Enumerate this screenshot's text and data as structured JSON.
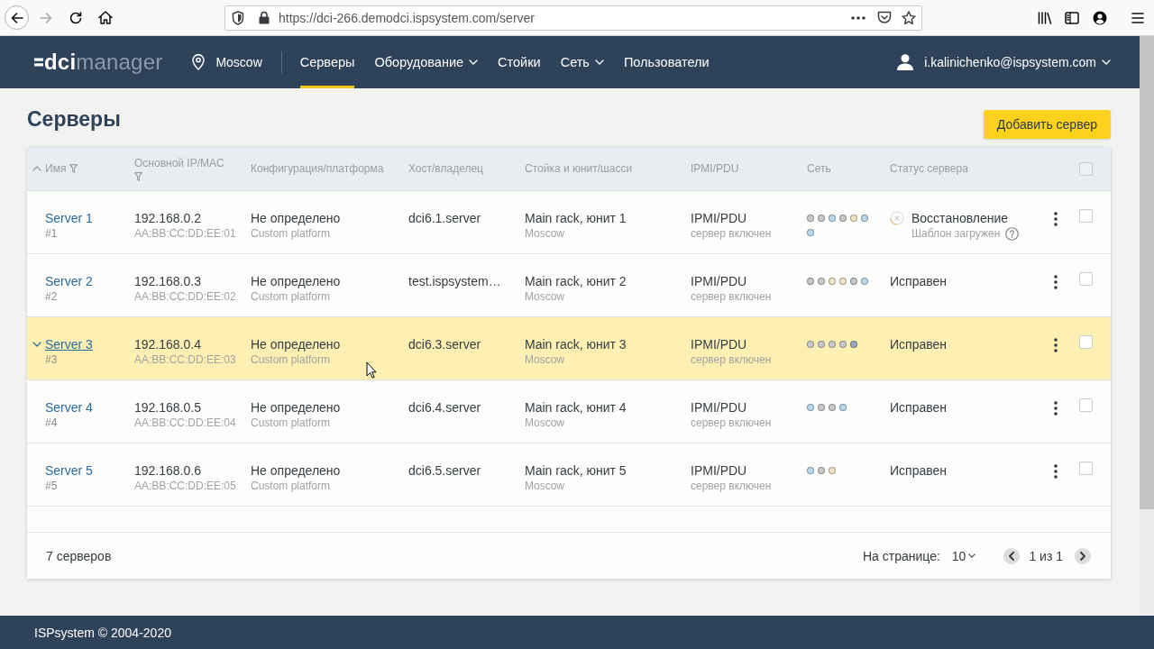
{
  "browser": {
    "url": "https://dci-266.demodci.ispsystem.com/server",
    "forward_disabled": true
  },
  "header": {
    "logo": "**dci**manager",
    "location": "Moscow",
    "nav": [
      {
        "label": "Серверы",
        "selected": true,
        "dropdown": false
      },
      {
        "label": "Оборудование",
        "selected": false,
        "dropdown": true
      },
      {
        "label": "Стойки",
        "selected": false,
        "dropdown": false
      },
      {
        "label": "Сеть",
        "selected": false,
        "dropdown": true
      },
      {
        "label": "Пользователи",
        "selected": false,
        "dropdown": false
      }
    ],
    "user": "i.kalinichenko@ispsystem.com"
  },
  "page": {
    "title": "Серверы",
    "add_button": "Добавить сервер"
  },
  "table": {
    "columns": [
      {
        "label": "Имя",
        "sorted": true,
        "filter": true
      },
      {
        "label": "Основной IP/MAC",
        "sorted": false,
        "filter": true
      },
      {
        "label": "Конфигурация/платформа",
        "sorted": false,
        "filter": false
      },
      {
        "label": "Хост/владелец",
        "sorted": false,
        "filter": false
      },
      {
        "label": "Стойка и юнит/шасси",
        "sorted": false,
        "filter": false
      },
      {
        "label": "IPMI/PDU",
        "sorted": false,
        "filter": false
      },
      {
        "label": "Сеть",
        "sorted": false,
        "filter": false
      },
      {
        "label": "Статус сервера",
        "sorted": false,
        "filter": false
      }
    ],
    "select_all": {
      "checked": false
    },
    "rows": [
      {
        "name": "Server 1",
        "id": "#1",
        "ip": "192.168.0.2",
        "mac": "AA:BB:CC:DD:EE:01",
        "config": "Не определено",
        "platform": "Custom platform",
        "host": "dci6.1.server",
        "rack": "Main rack, юнит 1",
        "location": "Moscow",
        "ipmi": "IPMI/PDU",
        "power": "сервер включен",
        "network": [
          {
            "color": "#c9c9c9"
          },
          {
            "color": "#c9c9c9"
          },
          {
            "color": "#b8d8ec"
          },
          {
            "color": "#c9c9c9"
          },
          {
            "color": "#f1e2c6"
          },
          {
            "color": "#b8d8ec"
          },
          {
            "color": "#b8d8ec"
          }
        ],
        "status": {
          "kind": "progress",
          "text": "Восстановление",
          "detail": "Шаблон загружен"
        },
        "selected": false,
        "checked": false
      },
      {
        "name": "Server 2",
        "id": "#2",
        "ip": "192.168.0.3",
        "mac": "AA:BB:CC:DD:EE:02",
        "config": "Не определено",
        "platform": "Custom platform",
        "host": "test.ispsystem…",
        "rack": "Main rack, юнит 2",
        "location": "Moscow",
        "ipmi": "IPMI/PDU",
        "power": "сервер включен",
        "network": [
          {
            "color": "#c9c9c9"
          },
          {
            "color": "#c9c9c9"
          },
          {
            "color": "#f1e2c6"
          },
          {
            "color": "#f1e2c6"
          },
          {
            "color": "#c9c9c9"
          },
          {
            "color": "#b8d8ec"
          }
        ],
        "status": {
          "kind": "ok",
          "text": "Исправен"
        },
        "selected": false,
        "checked": false
      },
      {
        "name": "Server 3",
        "id": "#3",
        "ip": "192.168.0.4",
        "mac": "AA:BB:CC:DD:EE:03",
        "config": "Не определено",
        "platform": "Custom platform",
        "host": "dci6.3.server",
        "rack": "Main rack, юнит 3",
        "location": "Moscow",
        "ipmi": "IPMI/PDU",
        "power": "сервер включен",
        "network": [
          {
            "color": "#c9c9c9"
          },
          {
            "color": "#c9c9c9"
          },
          {
            "color": "#c9c9c9"
          },
          {
            "color": "#c9c9c9"
          },
          {
            "color": "#9eabbb"
          }
        ],
        "status": {
          "kind": "ok",
          "text": "Исправен"
        },
        "selected": true,
        "checked": false
      },
      {
        "name": "Server 4",
        "id": "#4",
        "ip": "192.168.0.5",
        "mac": "AA:BB:CC:DD:EE:04",
        "config": "Не определено",
        "platform": "Custom platform",
        "host": "dci6.4.server",
        "rack": "Main rack, юнит 4",
        "location": "Moscow",
        "ipmi": "IPMI/PDU",
        "power": "сервер включен",
        "network": [
          {
            "color": "#b8d8ec"
          },
          {
            "color": "#c9c9c9"
          },
          {
            "color": "#c9c9c9"
          },
          {
            "color": "#b8d8ec"
          }
        ],
        "status": {
          "kind": "ok",
          "text": "Исправен"
        },
        "selected": false,
        "checked": false
      },
      {
        "name": "Server 5",
        "id": "#5",
        "ip": "192.168.0.6",
        "mac": "AA:BB:CC:DD:EE:05",
        "config": "Не определено",
        "platform": "Custom platform",
        "host": "dci6.5.server",
        "rack": "Main rack, юнит 5",
        "location": "Moscow",
        "ipmi": "IPMI/PDU",
        "power": "сервер включен",
        "network": [
          {
            "color": "#b8d8ec"
          },
          {
            "color": "#c9c9c9"
          },
          {
            "color": "#f1e2c6"
          }
        ],
        "status": {
          "kind": "ok",
          "text": "Исправен"
        },
        "selected": false,
        "checked": false
      }
    ],
    "footer": {
      "count": "7 серверов",
      "per_page_label": "На странице:",
      "per_page": "10",
      "page": "1 из 1"
    }
  },
  "copyright": "ISPsystem © 2004-2020"
}
